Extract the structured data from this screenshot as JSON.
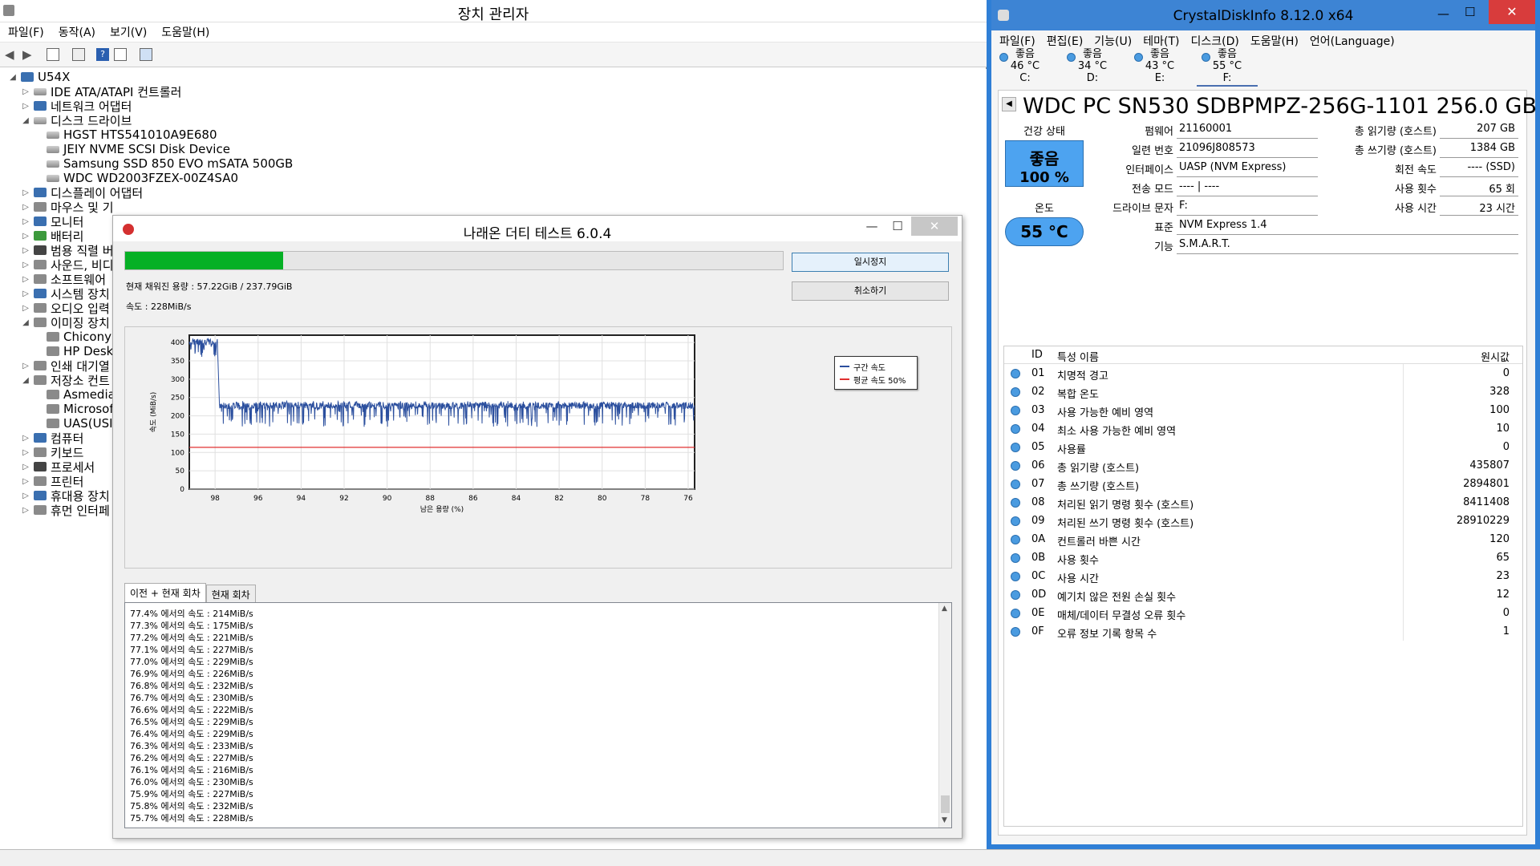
{
  "device_manager": {
    "title": "장치 관리자",
    "menu": [
      "파일(F)",
      "동작(A)",
      "보기(V)",
      "도움말(H)"
    ],
    "tree": [
      {
        "label": "U54X",
        "level": 0,
        "expanded": true,
        "icon": "computer"
      },
      {
        "label": "IDE ATA/ATAPI 컨트롤러",
        "level": 1,
        "expanded": false,
        "icon": "disk"
      },
      {
        "label": "네트워크 어댑터",
        "level": 1,
        "expanded": false,
        "icon": "network"
      },
      {
        "label": "디스크 드라이브",
        "level": 1,
        "expanded": true,
        "icon": "disk"
      },
      {
        "label": "HGST HTS541010A9E680",
        "level": 2,
        "icon": "disk"
      },
      {
        "label": "JEIY NVME SCSI Disk Device",
        "level": 2,
        "icon": "disk"
      },
      {
        "label": "Samsung SSD 850 EVO mSATA 500GB",
        "level": 2,
        "icon": "disk"
      },
      {
        "label": "WDC WD2003FZEX-00Z4SA0",
        "level": 2,
        "icon": "disk"
      },
      {
        "label": "디스플레이 어댑터",
        "level": 1,
        "expanded": false,
        "icon": "display"
      },
      {
        "label": "마우스 및 기",
        "level": 1,
        "expanded": false,
        "icon": "mouse"
      },
      {
        "label": "모니터",
        "level": 1,
        "expanded": false,
        "icon": "monitor"
      },
      {
        "label": "배터리",
        "level": 1,
        "expanded": false,
        "icon": "battery"
      },
      {
        "label": "범용 직렬 버",
        "level": 1,
        "expanded": false,
        "icon": "usb"
      },
      {
        "label": "사운드, 비디",
        "level": 1,
        "expanded": false,
        "icon": "sound"
      },
      {
        "label": "소프트웨어",
        "level": 1,
        "expanded": false,
        "icon": "software"
      },
      {
        "label": "시스템 장치",
        "level": 1,
        "expanded": false,
        "icon": "system"
      },
      {
        "label": "오디오 입력",
        "level": 1,
        "expanded": false,
        "icon": "audio"
      },
      {
        "label": "이미징 장치",
        "level": 1,
        "expanded": true,
        "icon": "camera"
      },
      {
        "label": "Chicony",
        "level": 2,
        "icon": "camera"
      },
      {
        "label": "HP Desk",
        "level": 2,
        "icon": "camera"
      },
      {
        "label": "인쇄 대기열",
        "level": 1,
        "expanded": false,
        "icon": "printer"
      },
      {
        "label": "저장소 컨트",
        "level": 1,
        "expanded": true,
        "icon": "storage"
      },
      {
        "label": "Asmedia",
        "level": 2,
        "icon": "storage"
      },
      {
        "label": "Microsof",
        "level": 2,
        "icon": "storage"
      },
      {
        "label": "UAS(USI",
        "level": 2,
        "icon": "storage"
      },
      {
        "label": "컴퓨터",
        "level": 1,
        "expanded": false,
        "icon": "computer"
      },
      {
        "label": "키보드",
        "level": 1,
        "expanded": false,
        "icon": "keyboard"
      },
      {
        "label": "프로세서",
        "level": 1,
        "expanded": false,
        "icon": "cpu"
      },
      {
        "label": "프린터",
        "level": 1,
        "expanded": false,
        "icon": "printer"
      },
      {
        "label": "휴대용 장치",
        "level": 1,
        "expanded": false,
        "icon": "portable"
      },
      {
        "label": "휴먼 인터페",
        "level": 1,
        "expanded": false,
        "icon": "hid"
      }
    ]
  },
  "dirty_test": {
    "title": "나래온 더티 테스트 6.0.4",
    "progress": 0.24,
    "filled_label": "현재 채워진 용량 : 57.22GiB / 237.79GiB",
    "speed_label": "속도 : 228MiB/s",
    "pause_button": "일시정지",
    "cancel_button": "취소하기",
    "tabs": [
      "이전 + 현재 회차",
      "현재 회차"
    ],
    "log": [
      "77.4% 에서의 속도 : 214MiB/s",
      "77.3% 에서의 속도 : 175MiB/s",
      "77.2% 에서의 속도 : 221MiB/s",
      "77.1% 에서의 속도 : 227MiB/s",
      "77.0% 에서의 속도 : 229MiB/s",
      "76.9% 에서의 속도 : 226MiB/s",
      "76.8% 에서의 속도 : 232MiB/s",
      "76.7% 에서의 속도 : 230MiB/s",
      "76.6% 에서의 속도 : 222MiB/s",
      "76.5% 에서의 속도 : 229MiB/s",
      "76.4% 에서의 속도 : 229MiB/s",
      "76.3% 에서의 속도 : 233MiB/s",
      "76.2% 에서의 속도 : 227MiB/s",
      "76.1% 에서의 속도 : 216MiB/s",
      "76.0% 에서의 속도 : 230MiB/s",
      "75.9% 에서의 속도 : 227MiB/s",
      "75.8% 에서의 속도 : 232MiB/s",
      "75.7% 에서의 속도 : 228MiB/s"
    ]
  },
  "chart_data": {
    "type": "line",
    "title": "",
    "xlabel": "남은 용량 (%)",
    "ylabel": "속도 (MiB/s)",
    "xlim": [
      99.2,
      75.7
    ],
    "ylim": [
      0,
      420
    ],
    "x_ticks": [
      98,
      96,
      94,
      92,
      90,
      88,
      86,
      84,
      82,
      80,
      78,
      76
    ],
    "y_ticks": [
      0,
      50,
      100,
      150,
      200,
      250,
      300,
      350,
      400
    ],
    "grid": true,
    "legend_position": "right",
    "series": [
      {
        "name": "구간 속도",
        "color": "#2b4f9e",
        "segments": [
          {
            "x_start": 99.2,
            "x_end": 97.9,
            "mean": 402,
            "min": 360,
            "max": 420
          },
          {
            "x_start": 97.8,
            "x_end": 75.7,
            "mean": 228,
            "min": 170,
            "max": 240
          }
        ]
      },
      {
        "name": "평균 속도 50%",
        "color": "#e03030",
        "value": 114
      }
    ]
  },
  "crystaldiskinfo": {
    "title": "CrystalDiskInfo 8.12.0 x64",
    "menu": [
      "파일(F)",
      "편집(E)",
      "기능(U)",
      "테마(T)",
      "디스크(D)",
      "도움말(H)",
      "언어(Language)"
    ],
    "drives": [
      {
        "status": "좋음",
        "temp": "46 °C",
        "letter": "C:"
      },
      {
        "status": "좋음",
        "temp": "34 °C",
        "letter": "D:"
      },
      {
        "status": "좋음",
        "temp": "43 °C",
        "letter": "E:"
      },
      {
        "status": "좋음",
        "temp": "55 °C",
        "letter": "F:"
      }
    ],
    "model": "WDC PC SN530 SDBPMPZ-256G-1101 256.0 GB",
    "health_label": "건강 상태",
    "health_status": "좋음",
    "health_percent": "100 %",
    "temp_label": "온도",
    "temp_value": "55 °C",
    "fields": {
      "firmware_label": "펌웨어",
      "firmware": "21160001",
      "serial_label": "일련 번호",
      "serial": "21096J808573",
      "interface_label": "인터페이스",
      "interface": "UASP (NVM Express)",
      "transfer_label": "전송 모드",
      "transfer": "---- | ----",
      "letter_label": "드라이브 문자",
      "letter": "F:",
      "standard_label": "표준",
      "standard": "NVM Express 1.4",
      "features_label": "기능",
      "features": "S.M.A.R.T.",
      "reads_label": "총 읽기량 (호스트)",
      "reads": "207 GB",
      "writes_label": "총 쓰기량 (호스트)",
      "writes": "1384 GB",
      "rpm_label": "회전 속도",
      "rpm": "---- (SSD)",
      "count_label": "사용 횟수",
      "count": "65 회",
      "hours_label": "사용 시간",
      "hours": "23 시간"
    },
    "smart_headers": {
      "id": "ID",
      "name": "특성 이름",
      "raw": "원시값"
    },
    "smart": [
      {
        "id": "01",
        "name": "치명적 경고",
        "raw": "0"
      },
      {
        "id": "02",
        "name": "복합 온도",
        "raw": "328"
      },
      {
        "id": "03",
        "name": "사용 가능한 예비 영역",
        "raw": "100"
      },
      {
        "id": "04",
        "name": "최소 사용 가능한 예비 영역",
        "raw": "10"
      },
      {
        "id": "05",
        "name": "사용률",
        "raw": "0"
      },
      {
        "id": "06",
        "name": "총 읽기량 (호스트)",
        "raw": "435807"
      },
      {
        "id": "07",
        "name": "총 쓰기량 (호스트)",
        "raw": "2894801"
      },
      {
        "id": "08",
        "name": "처리된 읽기 명령 횟수 (호스트)",
        "raw": "8411408"
      },
      {
        "id": "09",
        "name": "처리된 쓰기 명령 횟수 (호스트)",
        "raw": "28910229"
      },
      {
        "id": "0A",
        "name": "컨트롤러 바쁜 시간",
        "raw": "120"
      },
      {
        "id": "0B",
        "name": "사용 횟수",
        "raw": "65"
      },
      {
        "id": "0C",
        "name": "사용 시간",
        "raw": "23"
      },
      {
        "id": "0D",
        "name": "예기치 않은 전원 손실 횟수",
        "raw": "12"
      },
      {
        "id": "0E",
        "name": "매체/데이터 무결성 오류 횟수",
        "raw": "0"
      },
      {
        "id": "0F",
        "name": "오류 정보 기록 항목 수",
        "raw": "1"
      }
    ]
  }
}
